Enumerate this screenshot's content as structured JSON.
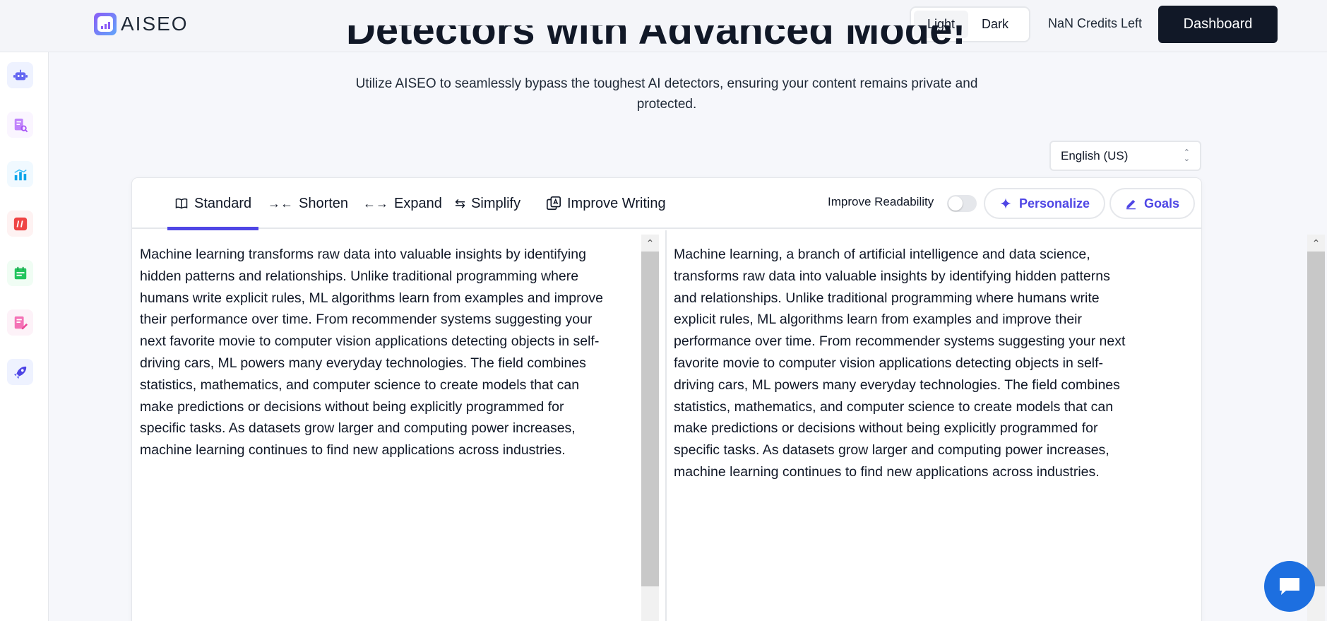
{
  "header": {
    "logo_text": "AISEO",
    "theme": {
      "light_label": "Light",
      "dark_label": "Dark",
      "active": "Light"
    },
    "credits_text": "NaN Credits Left",
    "dashboard_label": "Dashboard"
  },
  "sidebar": {
    "items": [
      {
        "icon": "robot-icon",
        "color": "#6366f1",
        "bg": "#eef2ff"
      },
      {
        "icon": "document-search-icon",
        "color": "#a855f7",
        "bg": "#faf5ff"
      },
      {
        "icon": "bar-chart-icon",
        "color": "#0ea5e9",
        "bg": "#f0f9ff"
      },
      {
        "icon": "hashtag-icon",
        "color": "#ef4444",
        "bg": "#fef2f2"
      },
      {
        "icon": "calendar-icon",
        "color": "#22c55e",
        "bg": "#f0fdf4"
      },
      {
        "icon": "document-edit-icon",
        "color": "#ec4899",
        "bg": "#fdf2f8"
      },
      {
        "icon": "rocket-icon",
        "color": "#4f46e5",
        "bg": "#eef2ff"
      }
    ]
  },
  "hero": {
    "title": "Detectors with Advanced Mode!",
    "subtitle": "Utilize AISEO to seamlessly bypass the toughest AI detectors, ensuring your content remains private and protected."
  },
  "language": {
    "selected": "English (US)"
  },
  "editor": {
    "tabs": [
      {
        "label": "Standard",
        "icon": "book-icon",
        "active": true
      },
      {
        "label": "Shorten",
        "icon": "shorten-arrows-icon",
        "active": false
      },
      {
        "label": "Expand",
        "icon": "expand-arrows-icon",
        "active": false
      },
      {
        "label": "Simplify",
        "icon": "swap-arrows-icon",
        "active": false
      },
      {
        "label": "Improve Writing",
        "icon": "improve-writing-icon",
        "active": false
      }
    ],
    "readability_label": "Improve Readability",
    "readability_on": false,
    "personalize_label": "Personalize",
    "goals_label": "Goals",
    "accent_color": "#4f46e5",
    "input_text": "Machine learning transforms raw data into valuable insights by identifying hidden patterns and relationships. Unlike traditional programming where humans write explicit rules, ML algorithms learn from examples and improve their performance over time. From recommender systems suggesting your next favorite movie to computer vision applications detecting objects in self-driving cars, ML powers many everyday technologies. The field combines statistics, mathematics, and computer science to create models that can make predictions or decisions without being explicitly programmed for specific tasks. As datasets grow larger and computing power increases, machine learning continues to find new applications across industries.",
    "output_text": "Machine learning, a branch of artificial intelligence and data science, transforms raw data into valuable insights by identifying hidden patterns and relationships. Unlike traditional programming where humans write explicit rules, ML algorithms learn from examples and improve their performance over time. From recommender systems suggesting your next favorite movie to computer vision applications detecting objects in self-driving cars, ML powers many everyday technologies. The field combines statistics, mathematics, and computer science to create models that can make predictions or decisions without being explicitly programmed for specific tasks. As datasets grow larger and computing power increases, machine learning continues to find new applications across industries."
  },
  "chat": {
    "icon": "chat-bubble-icon",
    "color": "#1d6fe0"
  }
}
